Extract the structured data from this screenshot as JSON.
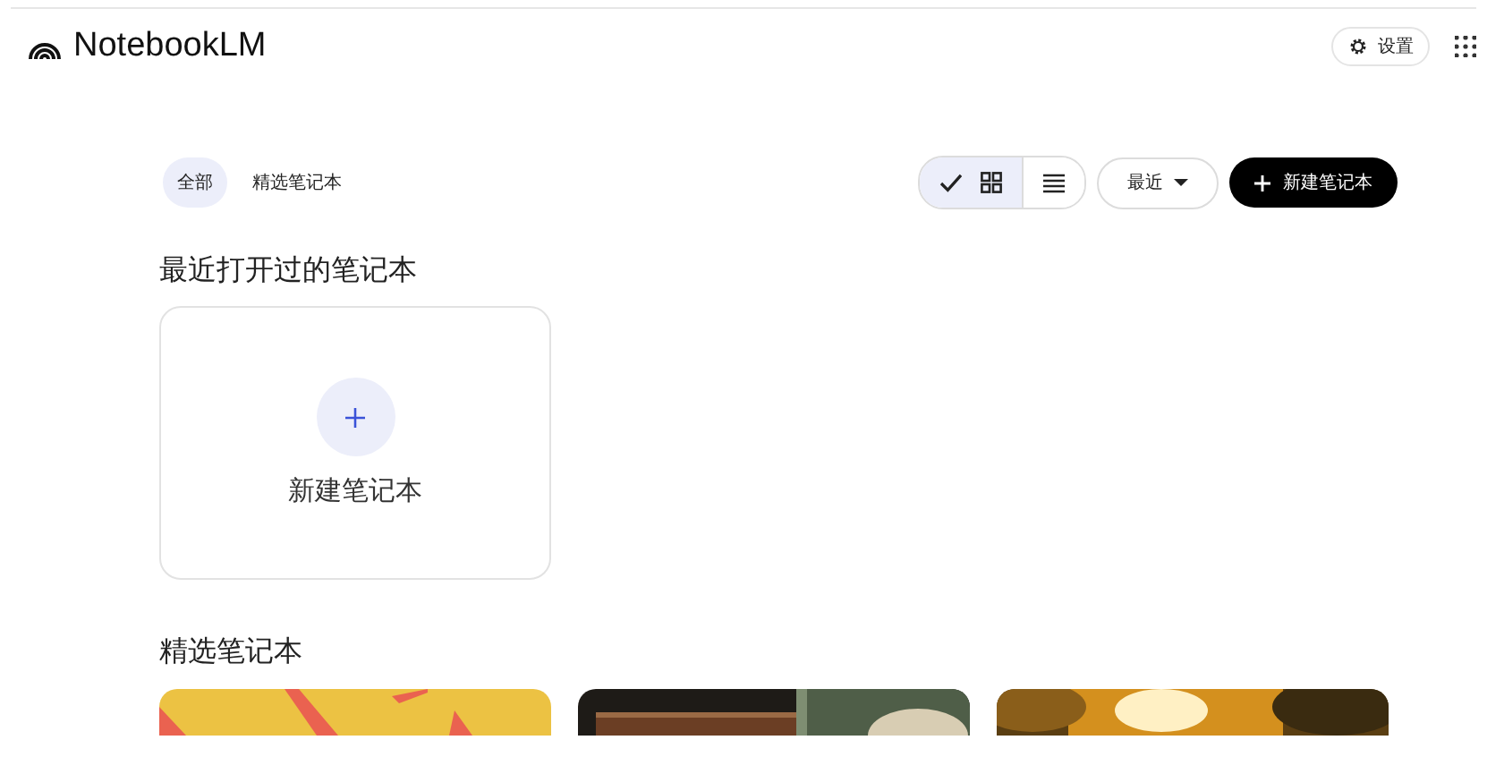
{
  "app": {
    "title": "NotebookLM"
  },
  "header": {
    "settings_label": "设置"
  },
  "filters": [
    {
      "label": "全部",
      "selected": true
    },
    {
      "label": "精选笔记本",
      "selected": false
    }
  ],
  "view_toggle": [
    {
      "kind": "grid",
      "selected": true
    },
    {
      "kind": "list",
      "selected": false
    }
  ],
  "sort": {
    "label": "最近"
  },
  "create_button": {
    "label": "新建笔记本"
  },
  "recent": {
    "heading": "最近打开过的笔记本",
    "create_card": {
      "label": "新建笔记本"
    }
  },
  "featured": {
    "heading": "精选笔记本"
  }
}
